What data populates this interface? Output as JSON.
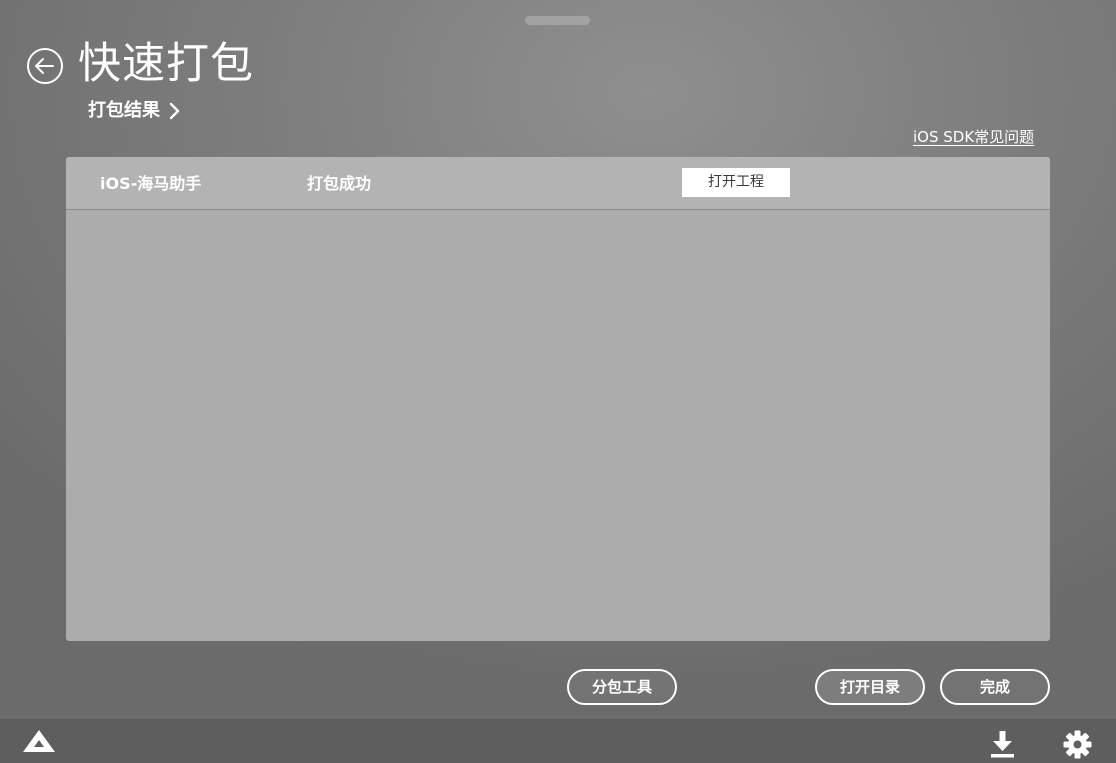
{
  "window": {
    "drag_handle_icon": "drag-handle"
  },
  "header": {
    "back_icon": "back-arrow-icon",
    "title": "快速打包",
    "breadcrumb": "打包结果",
    "breadcrumb_icon": "chevron-right-icon",
    "help_link": "iOS SDK常见问题"
  },
  "panel": {
    "app_name": "iOS-海马助手",
    "status": "打包成功",
    "open_project_label": "打开工程"
  },
  "actions": {
    "split_tool_label": "分包工具",
    "open_directory_label": "打开目录",
    "done_label": "完成"
  },
  "bottom_bar": {
    "logo_icon": "logo-icon",
    "download_icon": "download-icon",
    "settings_icon": "gear-icon"
  },
  "colors": {
    "text": "#ffffff",
    "panel_body": "#acacac",
    "panel_header": "#b3b3b3",
    "bottom_bar": "#5e5e5e",
    "primary_button_bg": "#ffffff",
    "primary_button_text": "#3a3a3a"
  }
}
